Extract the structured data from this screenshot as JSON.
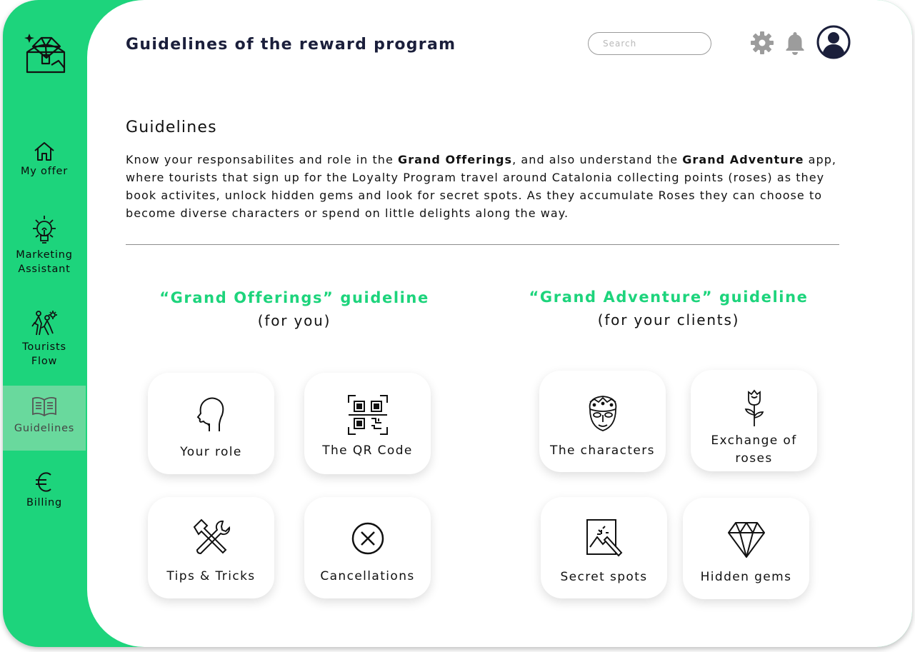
{
  "app": {
    "page_title": "Guidelines of the reward program",
    "logo_icon": "treasure-chest-icon",
    "brand_color": "#1dd47c",
    "title_color": "#1b1f3b"
  },
  "header": {
    "search_placeholder": "Search",
    "settings_icon": "gear-icon",
    "notifications_icon": "bell-icon",
    "profile_icon": "user-avatar-icon"
  },
  "sidebar": {
    "items": [
      {
        "label_lines": [
          "My offer"
        ],
        "icon": "house-icon"
      },
      {
        "label_lines": [
          "Marketing",
          "Assistant"
        ],
        "icon": "lightbulb-icon"
      },
      {
        "label_lines": [
          "Tourists",
          "Flow"
        ],
        "icon": "tourists-icon"
      },
      {
        "label_lines": [
          "Guidelines"
        ],
        "icon": "open-book-icon",
        "active": true
      },
      {
        "label_lines": [
          "Billing"
        ],
        "icon": "euro-icon"
      }
    ]
  },
  "guidelines": {
    "title": "Guidelines",
    "intro": {
      "p1": "Know your responsabilites and role in the ",
      "b1": "Grand Offerings",
      "p2": ", and also understand the ",
      "b2": "Grand Adventure",
      "p3": " app, where tourists that sign up for the Loyalty Program travel around Catalonia collecting points (roses) as they book activites, unlock hidden gems and look for secret spots. As they accumulate Roses they can choose to become diverse characters or spend on little delights along the way."
    }
  },
  "offerings": {
    "title": "“Grand Offerings” guideline",
    "subtitle": "(for you)",
    "cards": [
      {
        "label": "Your role",
        "icon": "head-profile-icon"
      },
      {
        "label": "The QR Code",
        "icon": "qr-code-icon"
      },
      {
        "label": "Tips & Tricks",
        "icon": "tools-icon"
      },
      {
        "label": "Cancellations",
        "icon": "cancel-circle-icon"
      }
    ]
  },
  "adventure": {
    "title": "“Grand Adventure” guideline",
    "subtitle": "(for your clients)",
    "cards": [
      {
        "label": "The characters",
        "icon": "mask-character-icon"
      },
      {
        "label_lines": [
          "Exchange of",
          "roses"
        ],
        "icon": "rose-icon"
      },
      {
        "label": "Secret spots",
        "icon": "magic-map-icon"
      },
      {
        "label": "Hidden gems",
        "icon": "diamond-icon"
      }
    ]
  }
}
